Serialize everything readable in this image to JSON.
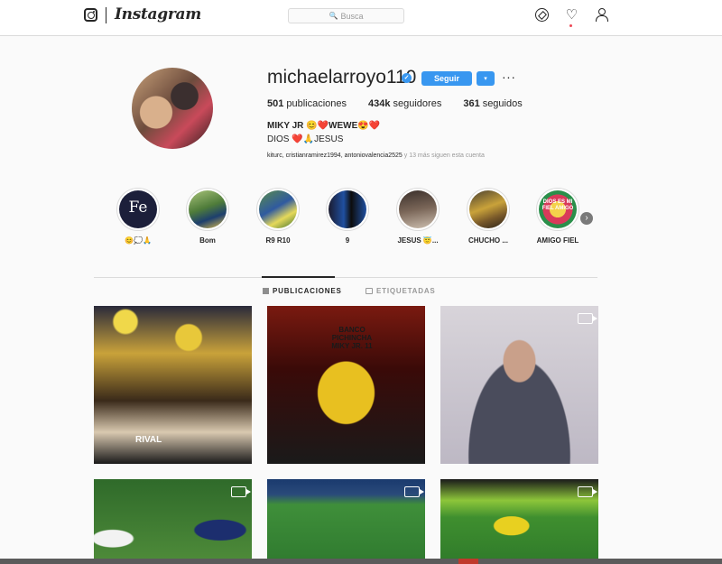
{
  "nav": {
    "wordmark": "Instagram",
    "search_placeholder": "Busca",
    "icons": [
      "instagram-logo-icon",
      "compass-icon",
      "heart-icon",
      "person-icon"
    ]
  },
  "profile": {
    "username": "michaelarroyo110",
    "follow_label": "Seguir",
    "dropdown_glyph": "▾",
    "more_glyph": "···",
    "verified_glyph": "✓",
    "stats": {
      "posts": {
        "count": "501",
        "label": "publicaciones"
      },
      "followers": {
        "count": "434k",
        "label": "seguidores"
      },
      "following": {
        "count": "361",
        "label": "seguidos"
      }
    },
    "bio_name": "MIKY JR 😊❤️WEWE😍❤️",
    "bio_line": "DIOS ❤️🙏JESUS",
    "followed_by_names": "kiturc, cristianramirez1994, antoniovalencia2525",
    "followed_by_more": " y 13 más siguen esta cuenta"
  },
  "highlights": [
    {
      "label": "😊💭🙏",
      "cover": "Fe"
    },
    {
      "label": "Bom"
    },
    {
      "label": "R9 R10"
    },
    {
      "label": "9"
    },
    {
      "label": "JESUS 😇..."
    },
    {
      "label": "CHUCHO ..."
    },
    {
      "label": "AMIGO FIEL",
      "cover": "DIOS ES MI FIEL AMIGO"
    }
  ],
  "highlights_next_glyph": "›",
  "tabs": [
    {
      "label": "PUBLICACIONES",
      "active": true
    },
    {
      "label": "ETIQUETADAS",
      "active": false
    }
  ],
  "posts": [
    {
      "kind": "photo",
      "caption": "RIVAL"
    },
    {
      "kind": "photo",
      "caption": "BANCO PICHINCHA MIKY JR. 11"
    },
    {
      "kind": "video"
    },
    {
      "kind": "video"
    },
    {
      "kind": "video"
    },
    {
      "kind": "video"
    }
  ],
  "colors": {
    "accent": "#3897f0",
    "notification": "#ed4956",
    "border": "#dbdbdb",
    "text": "#262626",
    "muted": "#999999"
  }
}
